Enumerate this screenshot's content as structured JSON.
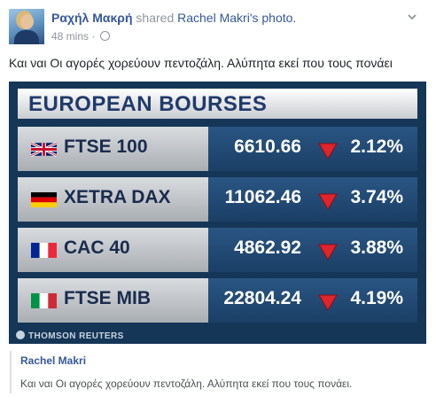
{
  "post": {
    "author": "Ραχήλ Μακρή",
    "action": "shared",
    "shared_source": "Rachel Makri's photo.",
    "time": "48 mins",
    "separator": "·",
    "text": "Και ναι Οι αγορές χορεύουν πεντοζάλη. Αλύπητα εκεί που τους πονάει"
  },
  "photo": {
    "title": "EUROPEAN BOURSES",
    "watermark": "THOMSON REUTERS",
    "rows": [
      {
        "name": "FTSE 100",
        "value": "6610.66",
        "change": "2.12%",
        "flag": "uk-flag-icon"
      },
      {
        "name": "XETRA DAX",
        "value": "11062.46",
        "change": "3.74%",
        "flag": "germany-flag-icon"
      },
      {
        "name": "CAC 40",
        "value": "4862.92",
        "change": "3.88%",
        "flag": "france-flag-icon"
      },
      {
        "name": "FTSE MIB",
        "value": "22804.24",
        "change": "4.19%",
        "flag": "italy-flag-icon"
      }
    ],
    "colors": {
      "down_arrow": "#e0242b",
      "panel": "#153657"
    }
  },
  "quote": {
    "author": "Rachel Makri",
    "text": "Και ναι Οι αγορές χορεύουν πεντοζάλη. Αλύπητα εκεί που τους πονάει."
  }
}
